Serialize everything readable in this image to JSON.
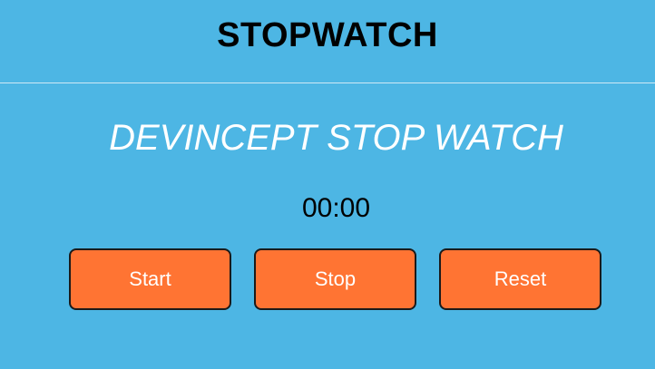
{
  "header": {
    "title": "STOPWATCH"
  },
  "main": {
    "subtitle": "DEVINCEPT STOP WATCH",
    "time_display": "00:00",
    "buttons": {
      "start_label": "Start",
      "stop_label": "Stop",
      "reset_label": "Reset"
    }
  },
  "colors": {
    "background": "#4db6e4",
    "button": "#ff7433",
    "button_text": "#ffffff",
    "subtitle_text": "#ffffff",
    "title_text": "#000000"
  }
}
